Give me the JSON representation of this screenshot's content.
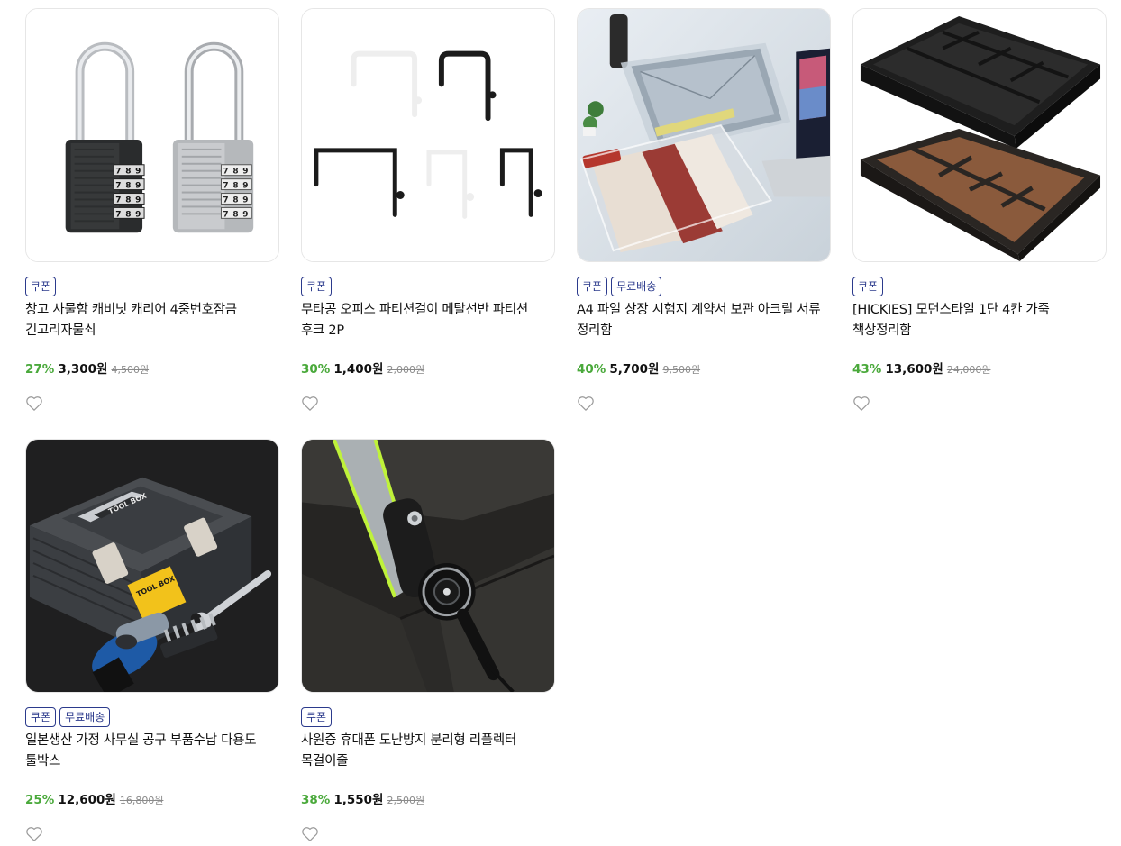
{
  "products": [
    {
      "badges": [
        "쿠폰"
      ],
      "title": "창고 사물함 캐비닛 캐리어 4중번호잠금 긴고리자물쇠",
      "discount": "27%",
      "price": "3,300원",
      "original_price": "4,500원",
      "image": "combination-padlock-image",
      "padlock_digits": [
        "7",
        "8",
        "9",
        "7",
        "8",
        "9",
        "7",
        "8",
        "9",
        "7",
        "8",
        "9"
      ]
    },
    {
      "badges": [
        "쿠폰"
      ],
      "title": "무타공 오피스 파티션걸이 메탈선반 파티션 후크 2P",
      "discount": "30%",
      "price": "1,400원",
      "original_price": "2,000원",
      "image": "partition-hook-image"
    },
    {
      "badges": [
        "쿠폰",
        "무료배송"
      ],
      "title": "A4 파일 상장 시험지 계약서 보관 아크릴 서류 정리함",
      "discount": "40%",
      "price": "5,700원",
      "original_price": "9,500원",
      "image": "acrylic-file-organizer-image"
    },
    {
      "badges": [
        "쿠폰"
      ],
      "title": "[HICKIES] 모던스타일 1단 4칸 가죽 책상정리함",
      "discount": "43%",
      "price": "13,600원",
      "original_price": "24,000원",
      "image": "leather-desk-tray-image"
    },
    {
      "badges": [
        "쿠폰",
        "무료배송"
      ],
      "title": "일본생산 가정 사무실 공구 부품수납 다용도 툴박스",
      "discount": "25%",
      "price": "12,600원",
      "original_price": "16,800원",
      "image": "tool-box-image",
      "toolbox_label": "TOOL BOX"
    },
    {
      "badges": [
        "쿠폰"
      ],
      "title": "사원증 휴대폰 도난방지 분리형 리플렉터 목걸이줄",
      "discount": "38%",
      "price": "1,550원",
      "original_price": "2,500원",
      "image": "reflective-lanyard-image"
    }
  ],
  "colors": {
    "discount": "#4aa93b",
    "badge": "#2b3a8c",
    "border": "#e6e6e6"
  },
  "icons": {
    "wishlist": "heart-outline-icon"
  }
}
